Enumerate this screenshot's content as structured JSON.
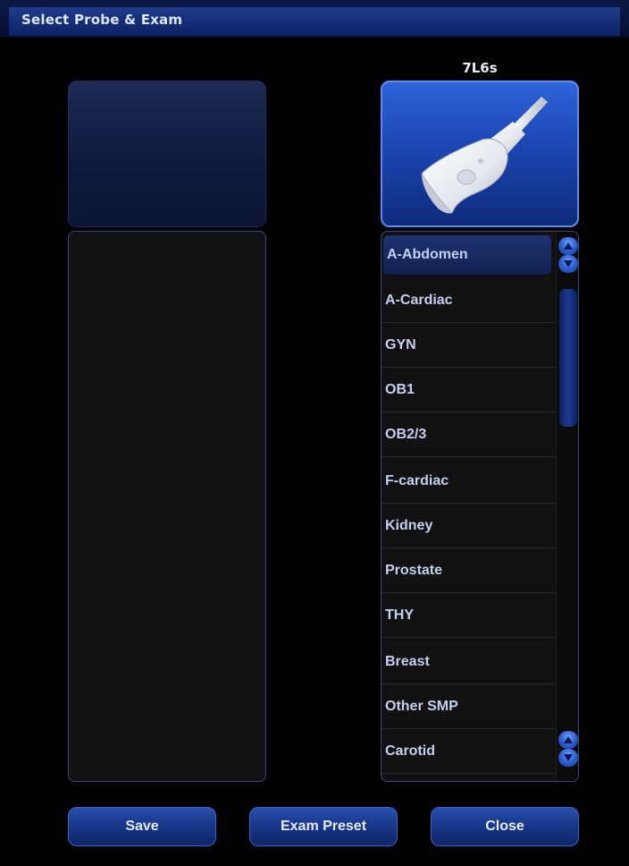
{
  "window": {
    "title": "Select Probe & Exam"
  },
  "probe": {
    "name": "7L6s"
  },
  "exam_list": {
    "items": [
      {
        "label": "A-Abdomen",
        "selected": true
      },
      {
        "label": "A-Cardiac",
        "selected": false
      },
      {
        "label": "GYN",
        "selected": false
      },
      {
        "label": "OB1",
        "selected": false
      },
      {
        "label": "OB2/3",
        "selected": false
      },
      {
        "label": "F-cardiac",
        "selected": false
      },
      {
        "label": "Kidney",
        "selected": false
      },
      {
        "label": "Prostate",
        "selected": false
      },
      {
        "label": "THY",
        "selected": false
      },
      {
        "label": "Breast",
        "selected": false
      },
      {
        "label": "Other SMP",
        "selected": false
      },
      {
        "label": "Carotid",
        "selected": false
      }
    ]
  },
  "buttons": {
    "save": "Save",
    "exam_preset": "Exam Preset",
    "close": "Close"
  },
  "icons": {
    "probe": "linear-probe-icon",
    "scroll_up": "arrow-up-icon",
    "scroll_down": "arrow-down-icon"
  },
  "colors": {
    "accent": "#2f63d9",
    "list_text": "#c5d0ef",
    "title_text": "#dbe6ff"
  }
}
